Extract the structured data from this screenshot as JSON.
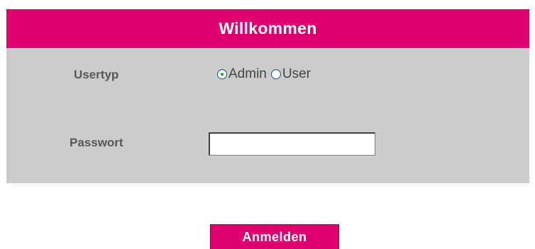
{
  "header": {
    "title": "Willkommen"
  },
  "form": {
    "usertype_label": "Usertyp",
    "usertype_options": [
      {
        "label": "Admin",
        "checked": true
      },
      {
        "label": "User",
        "checked": false
      }
    ],
    "password_label": "Passwort",
    "password_value": ""
  },
  "actions": {
    "submit_label": "Anmelden"
  },
  "colors": {
    "accent": "#e1006f",
    "panel_background": "#cccccc",
    "label_text": "#575757",
    "radio_dot": "#21a121"
  }
}
